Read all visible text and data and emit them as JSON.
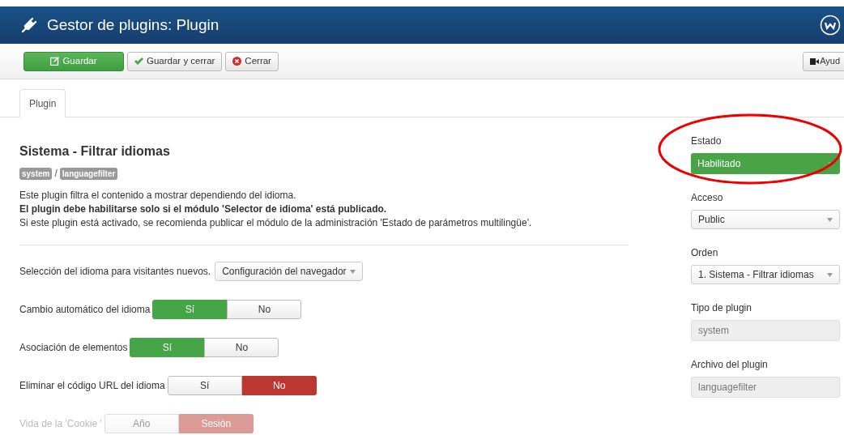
{
  "header": {
    "title": "Gestor de plugins: Plugin"
  },
  "toolbar": {
    "buttons": [
      {
        "kind": "save",
        "label": "Guardar"
      },
      {
        "kind": "save-close",
        "label": "Guardar y cerrar"
      },
      {
        "kind": "close",
        "label": "Cerrar"
      }
    ],
    "help": {
      "label": "Ayud"
    }
  },
  "tabs": [
    {
      "label": "Plugin",
      "selected": true
    }
  ],
  "plugin": {
    "title": "Sistema - Filtrar idiomas",
    "badges": [
      "system",
      "languagefilter"
    ],
    "separator": "/",
    "description": [
      {
        "text": "Este plugin filtra el contenido a mostrar dependiendo del idioma.",
        "bold": false
      },
      {
        "text": "El plugin debe habilitarse solo si el módulo 'Selector de idioma' está publicado.",
        "bold": true
      },
      {
        "text": "Si este plugin está activado, se recomienda publicar el módulo de la administración 'Estado de parámetros multilingüe'.",
        "bold": false
      }
    ]
  },
  "options": [
    {
      "kind": "select",
      "label": "Selección del idioma para visitantes nuevos.",
      "value": "Configuración del navegador",
      "disabled": false
    },
    {
      "kind": "toggle",
      "label": "Cambio automático del idioma",
      "disabled": false,
      "choices": [
        {
          "label": "Sí",
          "selected": true
        },
        {
          "label": "No",
          "selected": false
        }
      ]
    },
    {
      "kind": "toggle",
      "label": "Asociación de elementos",
      "disabled": false,
      "choices": [
        {
          "label": "Sí",
          "selected": true
        },
        {
          "label": "No",
          "selected": false
        }
      ]
    },
    {
      "kind": "toggle",
      "label": "Eliminar el código URL del idioma",
      "disabled": false,
      "choices": [
        {
          "label": "Sí",
          "selected": false
        },
        {
          "label": "No",
          "selected": true
        }
      ]
    },
    {
      "kind": "toggle",
      "label": "Vida de la 'Cookie '",
      "disabled": true,
      "choices": [
        {
          "label": "Año",
          "selected": false
        },
        {
          "label": "Sesión",
          "selected": true
        }
      ]
    }
  ],
  "sidebar": [
    {
      "kind": "status-select",
      "label": "Estado",
      "value": "Habilitado",
      "color": "#48a447",
      "highlighted": true
    },
    {
      "kind": "select",
      "label": "Acceso",
      "value": "Public"
    },
    {
      "kind": "select",
      "label": "Orden",
      "value": "1. Sistema - Filtrar idiomas"
    },
    {
      "kind": "readonly",
      "label": "Tipo de plugin",
      "value": "system"
    },
    {
      "kind": "readonly",
      "label": "Archivo del plugin",
      "value": "languagefilter"
    }
  ]
}
